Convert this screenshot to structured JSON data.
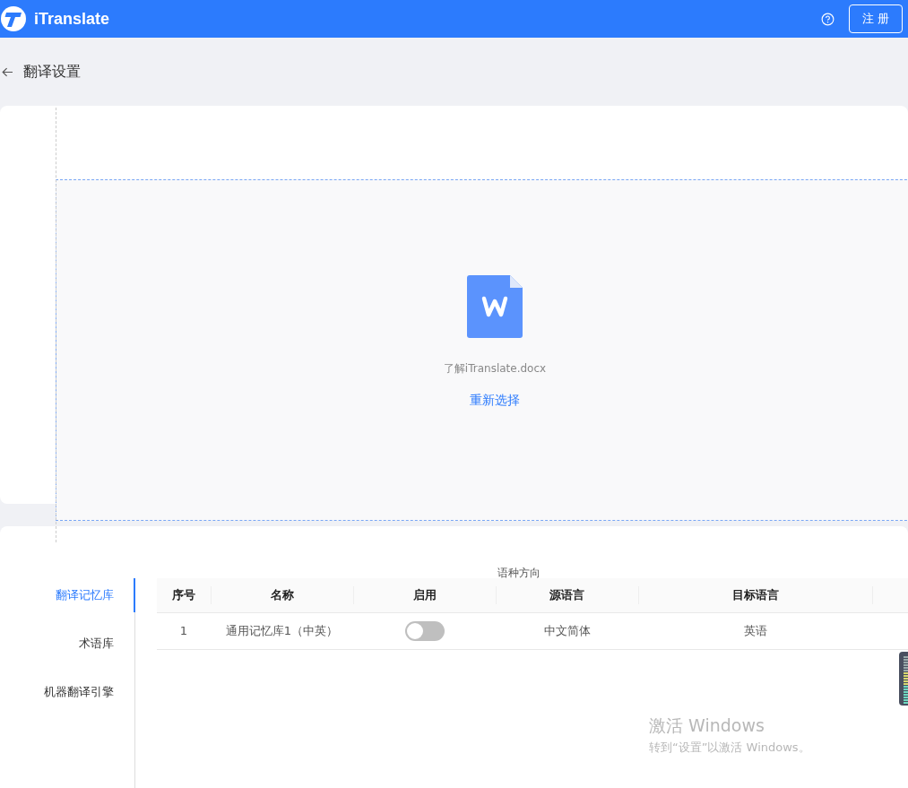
{
  "header": {
    "brand": "iTranslate",
    "register_button": "注 册"
  },
  "page": {
    "title": "翻译设置"
  },
  "upload": {
    "file_name": "了解iTranslate.docx",
    "reselect_link": "重新选择"
  },
  "settings_tabs": [
    {
      "label": "翻译记忆库",
      "selected": true
    },
    {
      "label": "术语库",
      "selected": false
    },
    {
      "label": "机器翻译引擎",
      "selected": false
    }
  ],
  "table": {
    "group_label": "语种方向",
    "columns": [
      "序号",
      "名称",
      "启用",
      "源语言",
      "目标语言"
    ],
    "rows": [
      {
        "index": "1",
        "name": "通用记忆库1（中英）",
        "enabled": false,
        "source": "中文简体",
        "target": "英语"
      }
    ]
  },
  "windows_notice": {
    "title": "激活 Windows",
    "text": "转到“设置”以激活 Windows。"
  }
}
